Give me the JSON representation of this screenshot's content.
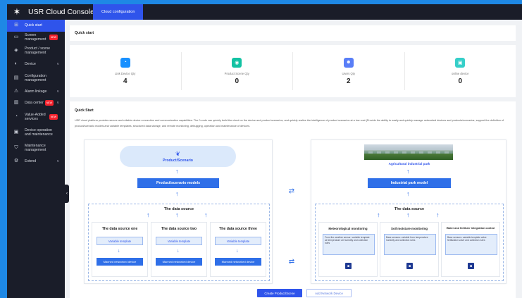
{
  "app": {
    "title": "USR Cloud Console",
    "active_tab": "Cloud configuration"
  },
  "sidebar": {
    "items": [
      {
        "label": "Quick start",
        "icon": "grid-icon",
        "active": true
      },
      {
        "label": "Screen management",
        "icon": "monitor-icon",
        "badge": "NEW"
      },
      {
        "label": "Product / scene management",
        "icon": "cube-icon"
      },
      {
        "label": "Device",
        "icon": "device-icon",
        "chevron": "∨"
      },
      {
        "label": "Configuration management",
        "icon": "config-icon"
      },
      {
        "label": "Alarm linkage",
        "icon": "alarm-icon",
        "chevron": "∨"
      },
      {
        "label": "Data center",
        "icon": "chart-icon",
        "badge": "NEW",
        "chevron": "∨"
      },
      {
        "label": "Value-Added services",
        "icon": "gift-icon",
        "badge": "NEW"
      },
      {
        "label": "Device operation and maintenance",
        "icon": "wrench-icon"
      },
      {
        "label": "Maintenance management",
        "icon": "shield-icon"
      },
      {
        "label": "Extend",
        "icon": "extend-icon",
        "chevron": "∨"
      }
    ]
  },
  "main": {
    "header": "Quick start",
    "stats": [
      {
        "label": "Link Device Qty",
        "value": "4",
        "color": "#1890ff",
        "icon": "link-icon",
        "glyph": "◔"
      },
      {
        "label": "Product Scene Qty",
        "value": "0",
        "color": "#13c2a3",
        "icon": "product-icon",
        "glyph": "◉"
      },
      {
        "label": "Users Qty",
        "value": "2",
        "color": "#597ef7",
        "icon": "user-icon",
        "glyph": "☻"
      },
      {
        "label": "online device",
        "value": "0",
        "color": "#36cfc9",
        "icon": "online-icon",
        "glyph": "▣"
      }
    ],
    "quickstart_title": "Quick Start",
    "quickstart_desc": "USR cloud platform provides secure and reliable device connection and communication capabilities. The 0-code can quickly build the cloud on the device and product scenarios, and quickly realize the intelligence of product scenarios at a low cost (Provide the ability to easily and quickly manage networked devices and products/scenarios, support the definition of product/scenario models and variable templates, structured data storage, and remote monitoring, debugging, operation and maintenance of devices."
  },
  "diagram": {
    "left": {
      "product_label": "Product/Scenario",
      "model_label": "Product/scenario models",
      "source_label": "The data source",
      "sources": [
        {
          "title": "The data source one",
          "template": "Variable template",
          "device": "Manned networked device"
        },
        {
          "title": "The data source two",
          "template": "Variable template",
          "device": "Manned networked device"
        },
        {
          "title": "The data source three",
          "template": "Variable template",
          "device": "Manned networked device"
        }
      ]
    },
    "right": {
      "park_label": "Agricultural industrial park",
      "model_label": "Industrial park model",
      "source_label": "The data source",
      "monitors": [
        {
          "title": "Meteorological monitoring",
          "text": "From the weather sensor: variable template air temperature air humidity and collection rules"
        },
        {
          "title": "Soil moisture monitoring",
          "text": "Base sensors: variable from temperature humidity and collection rules"
        },
        {
          "title": "Water and fertilizer integration control",
          "text": "Base sensors: variable template valve fertilization valve and collection rules"
        }
      ]
    }
  },
  "buttons": {
    "create": "Create Product/Scene",
    "add_device": "Add Network Device"
  }
}
